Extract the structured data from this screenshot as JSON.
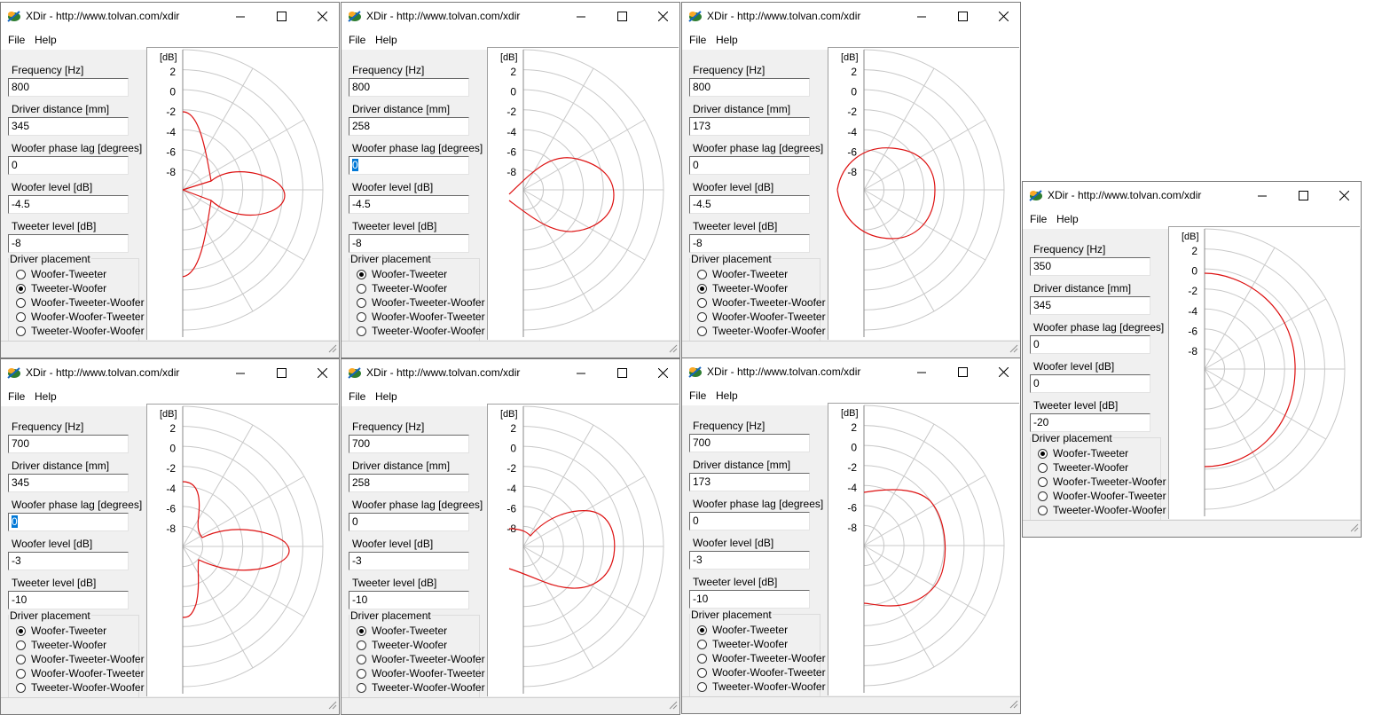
{
  "colors": {
    "curve": "#dd1111",
    "grid": "#c8c8c8",
    "selection": "#0078d7"
  },
  "labels": {
    "frequency": "Frequency [Hz]",
    "distance": "Driver distance [mm]",
    "phase": "Woofer phase lag [degrees]",
    "woofer_level": "Woofer level [dB]",
    "tweeter_level": "Tweeter level [dB]",
    "placement": "Driver placement",
    "placement_options": [
      "Woofer-Tweeter",
      "Tweeter-Woofer",
      "Woofer-Tweeter-Woofer",
      "Woofer-Woofer-Tweeter",
      "Tweeter-Woofer-Woofer"
    ],
    "axis_unit": "[dB]",
    "ticks": [
      "2",
      "0",
      "-2",
      "-4",
      "-6",
      "-8"
    ]
  },
  "windows": [
    {
      "title": "XDir - http://www.tolvan.com/xdir",
      "menu": [
        "File",
        "Help"
      ],
      "frequency": "800",
      "distance": "345",
      "phase": "0",
      "phase_selected": false,
      "woofer_level": "-4.5",
      "tweeter_level": "-8",
      "placement_selected": 1
    },
    {
      "title": "XDir - http://www.tolvan.com/xdir",
      "menu": [
        "File",
        "Help"
      ],
      "frequency": "800",
      "distance": "258",
      "phase": "0",
      "phase_selected": true,
      "woofer_level": "-4.5",
      "tweeter_level": "-8",
      "placement_selected": 0
    },
    {
      "title": "XDir - http://www.tolvan.com/xdir",
      "menu": [
        "File",
        "Help"
      ],
      "frequency": "800",
      "distance": "173",
      "phase": "0",
      "phase_selected": false,
      "woofer_level": "-4.5",
      "tweeter_level": "-8",
      "placement_selected": 1
    },
    {
      "title": "XDir - http://www.tolvan.com/xdir",
      "menu": [
        "File",
        "Help"
      ],
      "frequency": "700",
      "distance": "345",
      "phase": "0",
      "phase_selected": true,
      "woofer_level": "-3",
      "tweeter_level": "-10",
      "placement_selected": 0
    },
    {
      "title": "XDir - http://www.tolvan.com/xdir",
      "menu": [
        "File",
        "Help"
      ],
      "frequency": "700",
      "distance": "258",
      "phase": "0",
      "phase_selected": false,
      "woofer_level": "-3",
      "tweeter_level": "-10",
      "placement_selected": 0
    },
    {
      "title": "XDir - http://www.tolvan.com/xdir",
      "menu": [
        "File",
        "Help"
      ],
      "frequency": "700",
      "distance": "173",
      "phase": "0",
      "phase_selected": false,
      "woofer_level": "-3",
      "tweeter_level": "-10",
      "placement_selected": 0
    },
    {
      "title": "XDir - http://www.tolvan.com/xdir",
      "menu": [
        "File",
        "Help"
      ],
      "frequency": "350",
      "distance": "345",
      "phase": "0",
      "phase_selected": false,
      "woofer_level": "0",
      "tweeter_level": "-20",
      "placement_selected": 0
    }
  ]
}
